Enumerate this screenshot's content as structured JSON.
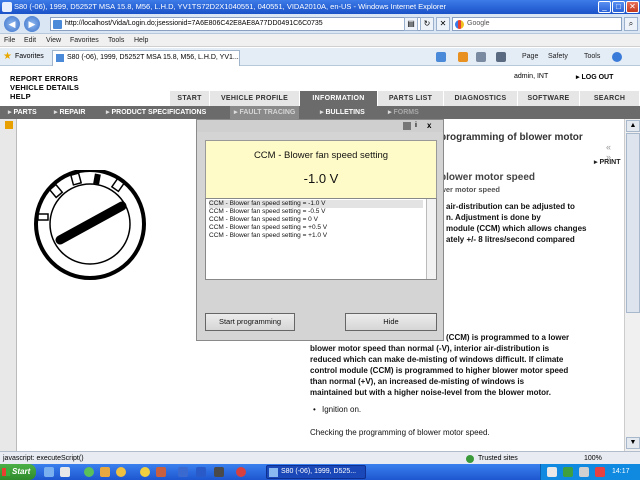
{
  "window": {
    "title": "S80 (-06), 1999, D5252T MSA 15.8, M56, L.H.D, YV1TS72D2X1040551, 040551, VIDA2010A, en-US - Windows Internet Explorer"
  },
  "browser": {
    "url": "http://localhost/Vida/Login.do;jsessionid=7A6E806C42E8AE8A77DD0491C6C0735",
    "search_placeholder": "Google",
    "menu": [
      "File",
      "Edit",
      "View",
      "Favorites",
      "Tools",
      "Help"
    ],
    "favorites_label": "Favorites",
    "tab_title": "S80 (-06), 1999, D5252T MSA 15.8, M56, L.H.D, YV1...",
    "commands": {
      "page": "Page",
      "safety": "Safety",
      "tools": "Tools"
    }
  },
  "header": {
    "links": [
      "REPORT ERRORS",
      "VEHICLE DETAILS",
      "HELP"
    ],
    "user": "admin, INT",
    "logout": "LOG OUT"
  },
  "main_tabs": [
    {
      "label": "START",
      "active": false
    },
    {
      "label": "VEHICLE PROFILE",
      "active": false
    },
    {
      "label": "INFORMATION",
      "active": true
    },
    {
      "label": "PARTS LIST",
      "active": false
    },
    {
      "label": "DIAGNOSTICS",
      "active": false
    },
    {
      "label": "SOFTWARE",
      "active": false
    },
    {
      "label": "SEARCH",
      "active": false
    }
  ],
  "sub_nav": [
    "PARTS",
    "REPAIR",
    "PRODUCT SPECIFICATIONS",
    "FAULT TRACING",
    "BULLETINS",
    "FORMS"
  ],
  "document": {
    "title": "programming of blower motor",
    "nav_arrows": "«\n»",
    "print": "PRINT",
    "heading": "blower motor speed",
    "subheading": "wer motor speed",
    "lines_top": [
      "air-distribution can be adjusted to",
      "n. Adjustment is done by",
      "module (CCM) which allows changes",
      "ately +/- 8 litres/second compared"
    ],
    "lines_bottom": [
      "(CCM) is programmed to a lower",
      "blower motor speed than normal (-V), interior air-distribution is",
      "reduced which can make de-misting of windows difficult. If climate",
      "control module (CCM) is programmed to higher blower motor speed",
      "than normal (+V), an increased de-misting of windows is",
      "maintained but with a higher noise-level from the blower motor."
    ],
    "bullet": "Ignition on.",
    "check_line": "Checking the programming of blower motor speed."
  },
  "dialog": {
    "info_label": "i",
    "close_label": "x",
    "heading": "CCM - Blower fan speed setting",
    "value": "-1.0 V",
    "options": [
      "CCM - Blower fan speed setting = -1.0 V",
      "CCM - Blower fan speed setting = -0.5 V",
      "CCM - Blower fan speed setting = 0 V",
      "CCM - Blower fan speed setting = +0.5 V",
      "CCM - Blower fan speed setting = +1.0 V"
    ],
    "selected_index": 0,
    "start_button": "Start programming",
    "hide_button": "Hide"
  },
  "status": {
    "text": "javascript: executeScript()",
    "zone": "Trusted sites",
    "zoom": "100%"
  },
  "taskbar": {
    "start": "Start",
    "window": "S80 (-06), 1999, D525...",
    "clock": "14:17"
  }
}
